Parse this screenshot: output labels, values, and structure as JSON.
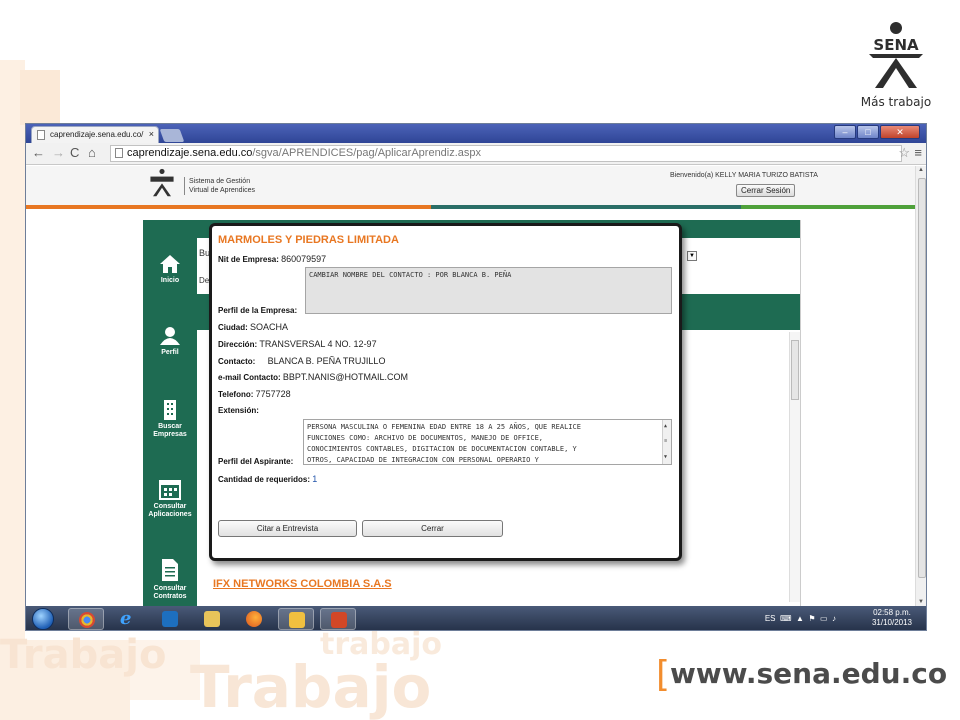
{
  "slide": {
    "logo_name": "SENA",
    "logo_tagline": "Más trabajo",
    "website": "www.sena.edu.co",
    "bg_words": [
      "Trabajo",
      "trabajo",
      "Trabajo"
    ]
  },
  "browser": {
    "tab_title": "caprendizaje.sena.edu.co/",
    "url_host": "caprendizaje.sena.edu.co",
    "url_path": "/sgva/APRENDICES/pag/AplicarAprendiz.aspx"
  },
  "site": {
    "logo_name": "SENA",
    "system_name_line1": "Sistema de Gestión",
    "system_name_line2": "Virtual de Aprendices",
    "welcome": "Bienvenido(a) KELLY MARIA TURIZO BATISTA",
    "logout_label": "Cerrar Sesión"
  },
  "sidebar": {
    "items": [
      {
        "label": "Inicio",
        "icon": "home-icon"
      },
      {
        "label": "Perfil",
        "icon": "user-icon"
      },
      {
        "label": "Buscar Empresas",
        "icon": "building-icon"
      },
      {
        "label": "Consultar Aplicaciones",
        "icon": "calendar-icon"
      },
      {
        "label": "Consultar Contratos",
        "icon": "document-icon"
      }
    ]
  },
  "content": {
    "partial_text_1": "Bu",
    "partial_text_2": "De",
    "next_company": "IFX NETWORKS COLOMBIA S.A.S"
  },
  "modal": {
    "company": "MARMOLES Y PIEDRAS LIMITADA",
    "nit_label": "Nit de Empresa:",
    "nit_value": "860079597",
    "profile_label": "Perfil de la Empresa:",
    "profile_text": "CAMBIAR NOMBRE DEL CONTACTO : POR BLANCA B. PEÑA",
    "city_label": "Ciudad:",
    "city_value": "SOACHA",
    "address_label": "Dirección:",
    "address_value": "TRANSVERSAL 4 NO. 12-97",
    "contact_label": "Contacto:",
    "contact_value": "BLANCA B. PEÑA TRUJILLO",
    "email_label": "e-mail Contacto:",
    "email_value": "BBPT.NANIS@HOTMAIL.COM",
    "phone_label": "Telefono:",
    "phone_value": "7757728",
    "ext_label": "Extensión:",
    "applicant_label": "Perfil del Aspirante:",
    "applicant_text_lines": [
      "PERSONA MASCULINA O FEMENINA EDAD ENTRE 18 A 25 AÑOS, QUE REALICE",
      "FUNCIONES COMO: ARCHIVO DE DOCUMENTOS, MANEJO DE OFFICE,",
      "CONOCIMIENTOS CONTABLES, DIGITACION DE DOCUMENTACION CONTABLE, Y",
      "OTROS, CAPACIDAD DE INTEGRACION CON PERSONAL OPERARIO Y"
    ],
    "required_label": "Cantidad de requeridos:",
    "required_value": "1",
    "btn_interview": "Citar a Entrevista",
    "btn_close": "Cerrar"
  },
  "taskbar": {
    "lang": "ES",
    "time": "02:58 p.m.",
    "date": "31/10/2013"
  },
  "colors": {
    "sena_green": "#1e6b52",
    "sena_orange": "#e87722"
  }
}
